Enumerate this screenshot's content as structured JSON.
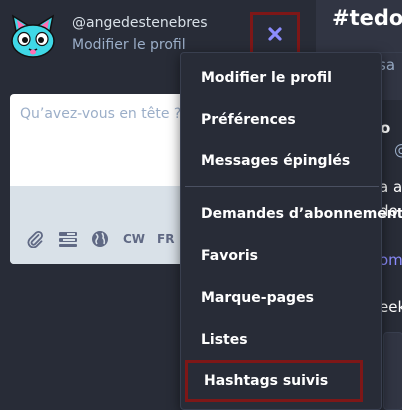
{
  "profile": {
    "username": "@angedestenebres",
    "edit_link": "Modifier le profil",
    "avatar_icon": "cyan-cat-avatar"
  },
  "close_button": {
    "icon": "close-icon",
    "color": "#8c8dff"
  },
  "compose": {
    "placeholder": "Qu’avez-vous en tête ?",
    "tools": {
      "attach_icon": "paperclip-icon",
      "poll_icon": "poll-icon",
      "privacy_icon": "globe-icon",
      "cw_label": "CW",
      "lang_label": "FR"
    }
  },
  "column": {
    "title": "#tedon",
    "bar_fragment": "sa",
    "fragments": [
      "o",
      "@",
      "a au",
      "do",
      "om",
      "eek"
    ]
  },
  "menu": {
    "items": [
      "Modifier le profil",
      "Préférences",
      "Messages épinglés",
      "Demandes d’abonnement",
      "Favoris",
      "Marque-pages",
      "Listes",
      "Hashtags suivis"
    ]
  },
  "colors": {
    "background": "#282c37",
    "menu_background": "#282c37",
    "highlight_border": "#7e1717",
    "accent": "#8c8dff",
    "link": "#9baec8"
  }
}
